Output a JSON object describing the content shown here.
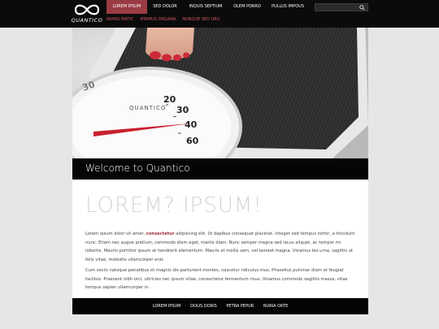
{
  "site": {
    "logo_text": "QUANTICO"
  },
  "nav": [
    {
      "label": "LOREM IPSUM",
      "active": true
    },
    {
      "label": "SED DOLOR",
      "active": false
    },
    {
      "label": "INQUIS SEPTIUM",
      "active": false
    },
    {
      "label": "OLEM PORRO",
      "active": false
    },
    {
      "label": "PULLUS IMPOUS",
      "active": false
    }
  ],
  "subnav": [
    "NUMIS MATIC",
    "IPRIMUS ORGANA",
    "NUNQUE SED URU"
  ],
  "search": {
    "placeholder": ""
  },
  "hero": {
    "welcome": "Welcome to Quantico"
  },
  "main": {
    "headline": "LOREM? IPSUM!",
    "p1_before": "Lorem ipsum dolor sit amet, ",
    "p1_em": "consectetur",
    "p1_after": " adipiscing elit. Ut dapibus consequat placerat. Integer sed tempus tortor, a tincidunt nunc. Etiam nec augue pretium, commodo diam eget, mattis diam. Nunc semper magna sed lacus aliquet, ac tempor mi lobortis. Mauris porttitor ipsum at hendrerit elementum. Mauris et mollis sem, vel laoreet magna. Vivamus leo urna, sagittis ut felis vitae, molestie ullamcorper erat.",
    "p2": "Cum sociis natoque penatibus et magnis dis parturient montes, nascetur ridiculus mus. Phasellus pulvinar diam et feugiat facilisis. Praesent nibh orci, ultricies nec ipsum vitae, consectetur fermentum risus. Vivamus commodo sagittis massa, vitae tempus sapien ullamcorper in."
  },
  "footer": [
    "LOREM IPSUM",
    "DOLIS DORIS",
    "PETRA PEPUR",
    "NURIA OKTE"
  ],
  "colors": {
    "accent": "#9b3b45",
    "subnav": "#d25563",
    "dark": "#050505"
  }
}
